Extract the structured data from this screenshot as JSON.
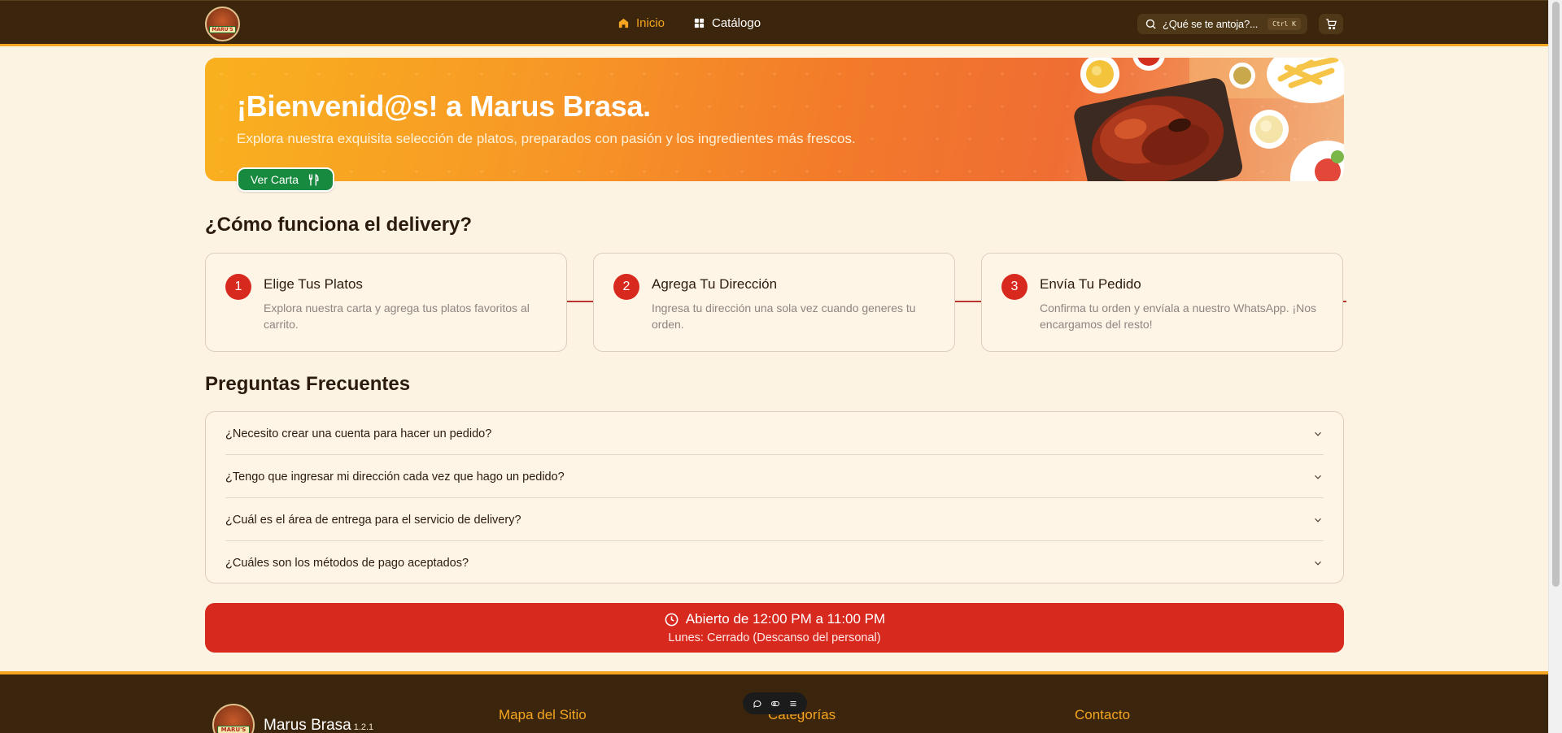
{
  "header": {
    "logo_text": "MARU'S",
    "nav": [
      {
        "label": "Inicio",
        "icon": "home-icon",
        "active": true
      },
      {
        "label": "Catálogo",
        "icon": "grid-icon",
        "active": false
      }
    ],
    "search": {
      "placeholder": "¿Qué se te antoja?...",
      "shortcut": "Ctrl K"
    },
    "cart_icon": "cart-icon"
  },
  "hero": {
    "title": "¡Bienvenid@s! a Marus Brasa.",
    "subtitle": "Explora nuestra exquisita selección de platos, preparados con pasión y los ingredientes más frescos.",
    "cta_label": "Ver Carta",
    "cta_icon": "utensils-icon"
  },
  "delivery": {
    "title": "¿Cómo funciona el delivery?",
    "steps": [
      {
        "number": "1",
        "title": "Elige Tus Platos",
        "description": "Explora nuestra carta y agrega tus platos favoritos al carrito."
      },
      {
        "number": "2",
        "title": "Agrega Tu Dirección",
        "description": "Ingresa tu dirección una sola vez cuando generes tu orden."
      },
      {
        "number": "3",
        "title": "Envía Tu Pedido",
        "description": "Confirma tu orden y envíala a nuestro WhatsApp. ¡Nos encargamos del resto!"
      }
    ]
  },
  "faq": {
    "title": "Preguntas Frecuentes",
    "items": [
      {
        "question": "¿Necesito crear una cuenta para hacer un pedido?"
      },
      {
        "question": "¿Tengo que ingresar mi dirección cada vez que hago un pedido?"
      },
      {
        "question": "¿Cuál es el área de entrega para el servicio de delivery?"
      },
      {
        "question": "¿Cuáles son los métodos de pago aceptados?"
      }
    ]
  },
  "hours": {
    "open": "Abierto de 12:00 PM a 11:00 PM",
    "closed": "Lunes: Cerrado (Descanso del personal)"
  },
  "footer": {
    "logo_text": "MARU'S",
    "brand": "Marus Brasa",
    "version": "1.2.1",
    "columns": [
      "Mapa del Sitio",
      "Categorías",
      "Contacto"
    ]
  },
  "colors": {
    "header_bg": "#3B260D",
    "accent": "#F5A51F",
    "primary_red": "#D8291F",
    "cta_green": "#178A3F",
    "page_bg": "#FDF3E3"
  }
}
